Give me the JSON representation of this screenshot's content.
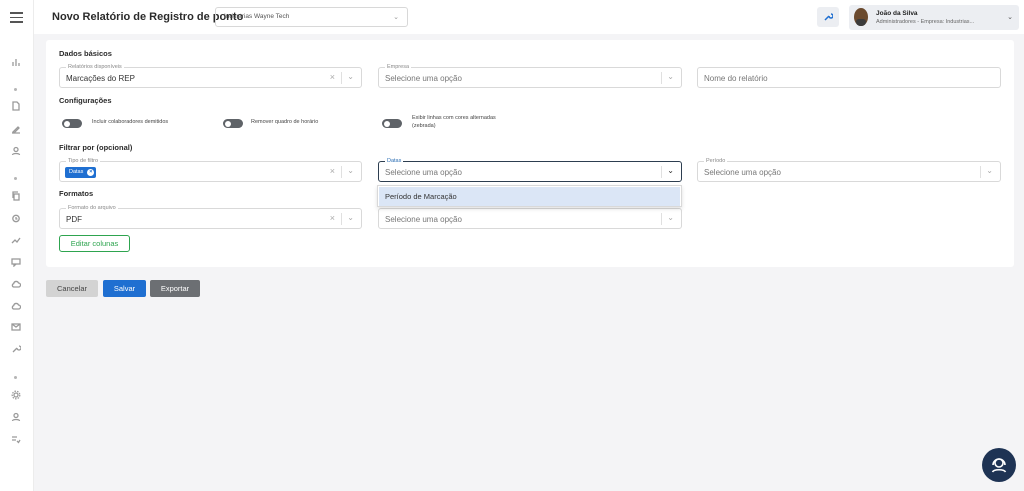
{
  "header": {
    "title": "Novo Relatório de Registro de ponto",
    "company_select": "Industrias Wayne Tech",
    "user_name": "João da Silva",
    "user_role": "Administradores - Empresa: Industrias..."
  },
  "sections": {
    "basic": "Dados básicos",
    "config": "Configurações",
    "filter": "Filtrar por (opcional)",
    "formats": "Formatos"
  },
  "basic": {
    "reports_label": "Relatórios disponíveis",
    "reports_value": "Marcações do REP",
    "company_label": "Empresa",
    "company_placeholder": "Selecione uma opção",
    "report_name_placeholder": "Nome do relatório"
  },
  "config": {
    "toggle1": "Incluir colaboradores demitidos",
    "toggle2": "Remover quadro de horário",
    "toggle3_line1": "Exibir linhas com cores alternadas",
    "toggle3_line2": "(zebrada)"
  },
  "filter": {
    "type_label": "Tipo de filtro",
    "type_chip": "Datas",
    "dates_label": "Datas",
    "dates_placeholder": "Selecione uma opção",
    "period_label": "Período",
    "period_placeholder": "Selecione uma opção",
    "dropdown_option": "Período de Marcação"
  },
  "formats": {
    "file_label": "Formato do arquivo",
    "file_value": "PDF",
    "second_placeholder": "Selecione uma opção",
    "edit_columns": "Editar colunas"
  },
  "actions": {
    "cancel": "Cancelar",
    "save": "Salvar",
    "export": "Exportar"
  },
  "colors": {
    "primary": "#1f6fd1",
    "success": "#2ea44f",
    "fab": "#1e3354"
  }
}
